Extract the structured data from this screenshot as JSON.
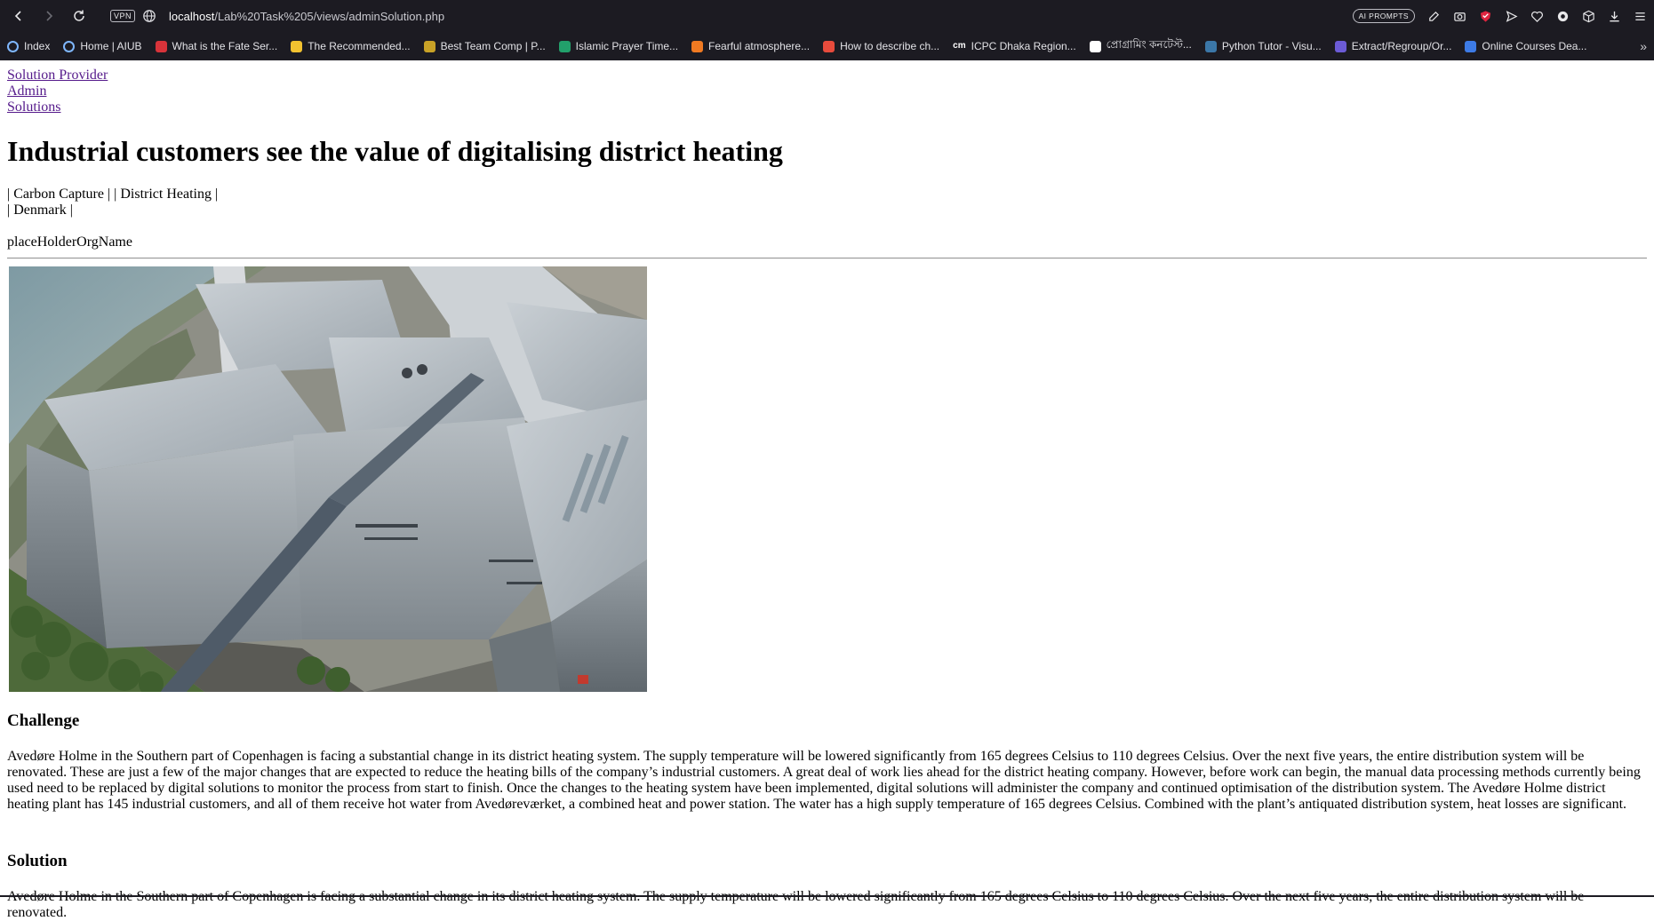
{
  "browser": {
    "vpn_label": "VPN",
    "url_host": "localhost",
    "url_path": "/Lab%20Task%205/views/adminSolution.php",
    "ai_prompts_label": "AI PROMPTS",
    "bookmarks": [
      {
        "label": "Index",
        "icon": "globe-icon",
        "color": "#7fb7ff"
      },
      {
        "label": "Home | AIUB",
        "icon": "globe-icon",
        "color": "#7fb7ff"
      },
      {
        "label": "What is the Fate Ser...",
        "icon": "bookmark-favicon",
        "color": "#d8333a"
      },
      {
        "label": "The Recommended...",
        "icon": "bookmark-favicon",
        "color": "#f2c230"
      },
      {
        "label": "Best Team Comp | P...",
        "icon": "bookmark-favicon",
        "color": "#c9a227"
      },
      {
        "label": "Islamic Prayer Time...",
        "icon": "bookmark-favicon",
        "color": "#22a06b"
      },
      {
        "label": "Fearful atmosphere...",
        "icon": "bookmark-favicon",
        "color": "#f07a22"
      },
      {
        "label": "How to describe ch...",
        "icon": "bookmark-favicon",
        "color": "#e84b3c"
      },
      {
        "label": "ICPC Dhaka Region...",
        "icon": "bookmark-favicon",
        "color": "#ffffff",
        "text_icon": "cm"
      },
      {
        "label": "প্রোগ্রামিং কনটেস্ট...",
        "icon": "file-icon",
        "color": "#ffffff"
      },
      {
        "label": "Python Tutor - Visu...",
        "icon": "bookmark-favicon",
        "color": "#3b77a8"
      },
      {
        "label": "Extract/Regroup/Or...",
        "icon": "bookmark-favicon",
        "color": "#6b5bd6"
      },
      {
        "label": "Online Courses Dea...",
        "icon": "bookmark-favicon",
        "color": "#3d7be6"
      }
    ],
    "more_label": "»"
  },
  "nav": {
    "links": [
      "Solution Provider",
      "Admin",
      "Solutions"
    ]
  },
  "article": {
    "title": "Industrial customers see the value of digitalising district heating",
    "tags_line1": "| Carbon Capture | | District Heating |",
    "tags_line2": "| Denmark |",
    "org_name": "placeHolderOrgName",
    "challenge_heading": "Challenge",
    "challenge_text": "Avedøre Holme in the Southern part of Copenhagen is facing a substantial change in its district heating system. The supply temperature will be lowered significantly from 165 degrees Celsius to 110 degrees Celsius. Over the next five years, the entire distribution system will be renovated. These are just a few of the major changes that are expected to reduce the heating bills of the company’s industrial customers. A great deal of work lies ahead for the district heating company. However, before work can begin, the manual data processing methods currently being used need to be replaced by digital solutions to monitor the process from start to finish. Once the changes to the heating system have been implemented, digital solutions will administer the company and continued optimisation of the distribution system. The Avedøre Holme district heating plant has 145 industrial customers, and all of them receive hot water from Avedøreværket, a combined heat and power station. The water has a high supply temperature of 165 degrees Celsius. Combined with the plant’s antiquated distribution system, heat losses are significant.",
    "solution_heading": "Solution",
    "solution_text": "Avedøre Holme in the Southern part of Copenhagen is facing a substantial change in its district heating system. The supply temperature will be lowered significantly from 165 degrees Celsius to 110 degrees Celsius. Over the next five years, the entire distribution system will be renovated."
  }
}
